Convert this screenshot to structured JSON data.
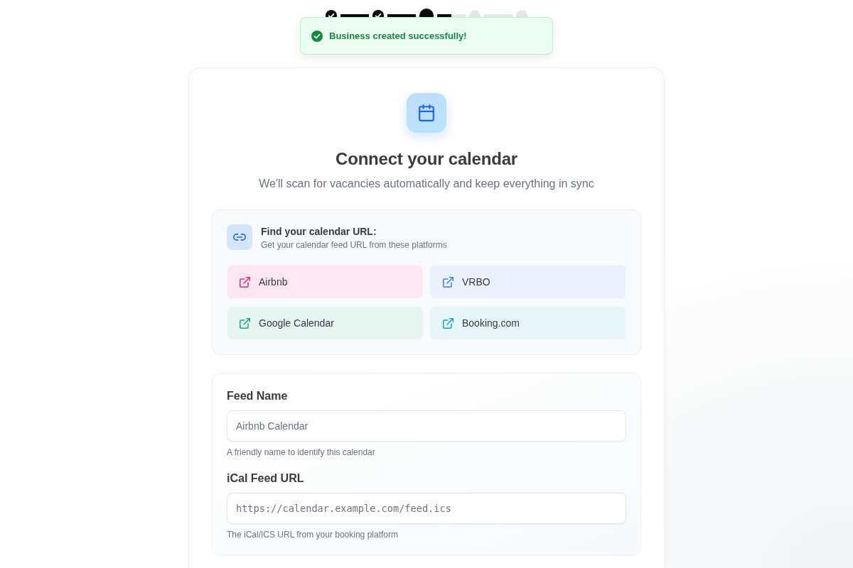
{
  "stepper": {
    "steps": [
      {
        "completed": true,
        "current": false
      },
      {
        "completed": true,
        "current": false
      },
      {
        "completed": false,
        "current": true
      },
      {
        "completed": false,
        "current": false
      },
      {
        "completed": false,
        "current": false
      }
    ],
    "connectors": [
      {
        "kind": "line",
        "completed": true
      },
      {
        "kind": "line",
        "completed": true
      },
      {
        "kind": "progress",
        "level": 0.5
      },
      {
        "kind": "line",
        "completed": false
      }
    ]
  },
  "toast": {
    "kind": "success",
    "message": "Business created successfully!"
  },
  "header": {
    "title": "Connect your calendar",
    "subtitle": "We'll scan for vacancies automatically and keep everything in sync"
  },
  "platforms": {
    "title": "Find your calendar URL:",
    "subtitle": "Get your calendar feed URL from these platforms",
    "links": [
      {
        "label": "Airbnb",
        "color": "#e6287a"
      },
      {
        "label": "VRBO",
        "color": "#3b82f6"
      },
      {
        "label": "Google Calendar",
        "color": "#16a57a"
      },
      {
        "label": "Booking.com",
        "color": "#14a3c7"
      }
    ]
  },
  "form": {
    "fields": [
      {
        "kind": "text",
        "label": "Feed Name",
        "placeholder": "Airbnb Calendar",
        "hint": "A friendly name to identify this calendar"
      },
      {
        "kind": "url",
        "label": "iCal Feed URL",
        "placeholder": "https://calendar.example.com/feed.ics",
        "hint": "The iCal/ICS URL from your booking platform"
      }
    ]
  }
}
